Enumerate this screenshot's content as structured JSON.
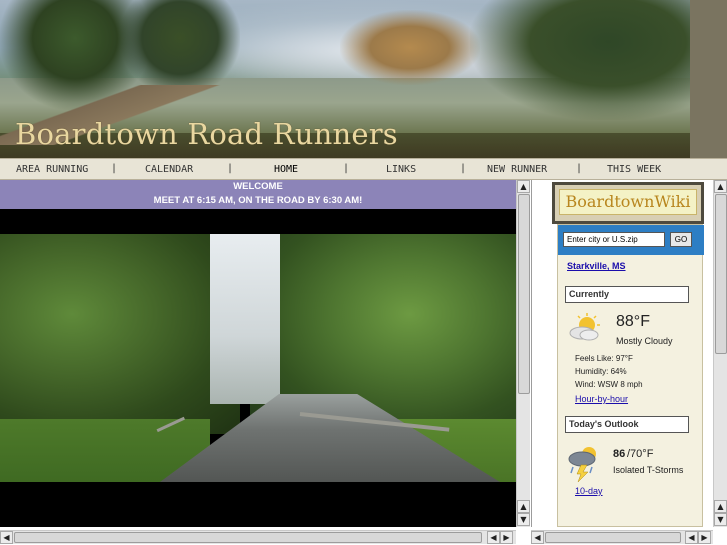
{
  "header": {
    "title": "Boardtown Road Runners"
  },
  "nav": {
    "items": [
      {
        "label": "AREA RUNNING"
      },
      {
        "label": "CALENDAR"
      },
      {
        "label": "HOME"
      },
      {
        "label": "LINKS"
      },
      {
        "label": "NEW RUNNER"
      },
      {
        "label": "THIS WEEK"
      }
    ],
    "separator": "|"
  },
  "main": {
    "welcome_title": "WELCOME",
    "welcome_subtitle": "MEET AT 6:15 AM, ON THE ROAD BY 6:30 AM!"
  },
  "sidebar": {
    "wiki_logo": "BoardtownWiki",
    "weather": {
      "input_placeholder": "Enter city or U.S.zip",
      "go_label": "GO",
      "location": "Starkville, MS",
      "currently_label": "Currently",
      "current_temp": "88°F",
      "current_condition": "Mostly Cloudy",
      "feels_like": "Feels Like: 97°F",
      "humidity": "Humidity: 64%",
      "wind": "Wind: WSW 8 mph",
      "hourly_link": "Hour-by-hour",
      "outlook_label": "Today's Outlook",
      "outlook_high": "86",
      "outlook_low": "/70°F",
      "outlook_condition": "Isolated T-Storms",
      "tenday_link": "10-day"
    }
  },
  "scrollbar_glyphs": {
    "up": "▲",
    "down": "▼",
    "left": "◀",
    "right": "▶"
  }
}
